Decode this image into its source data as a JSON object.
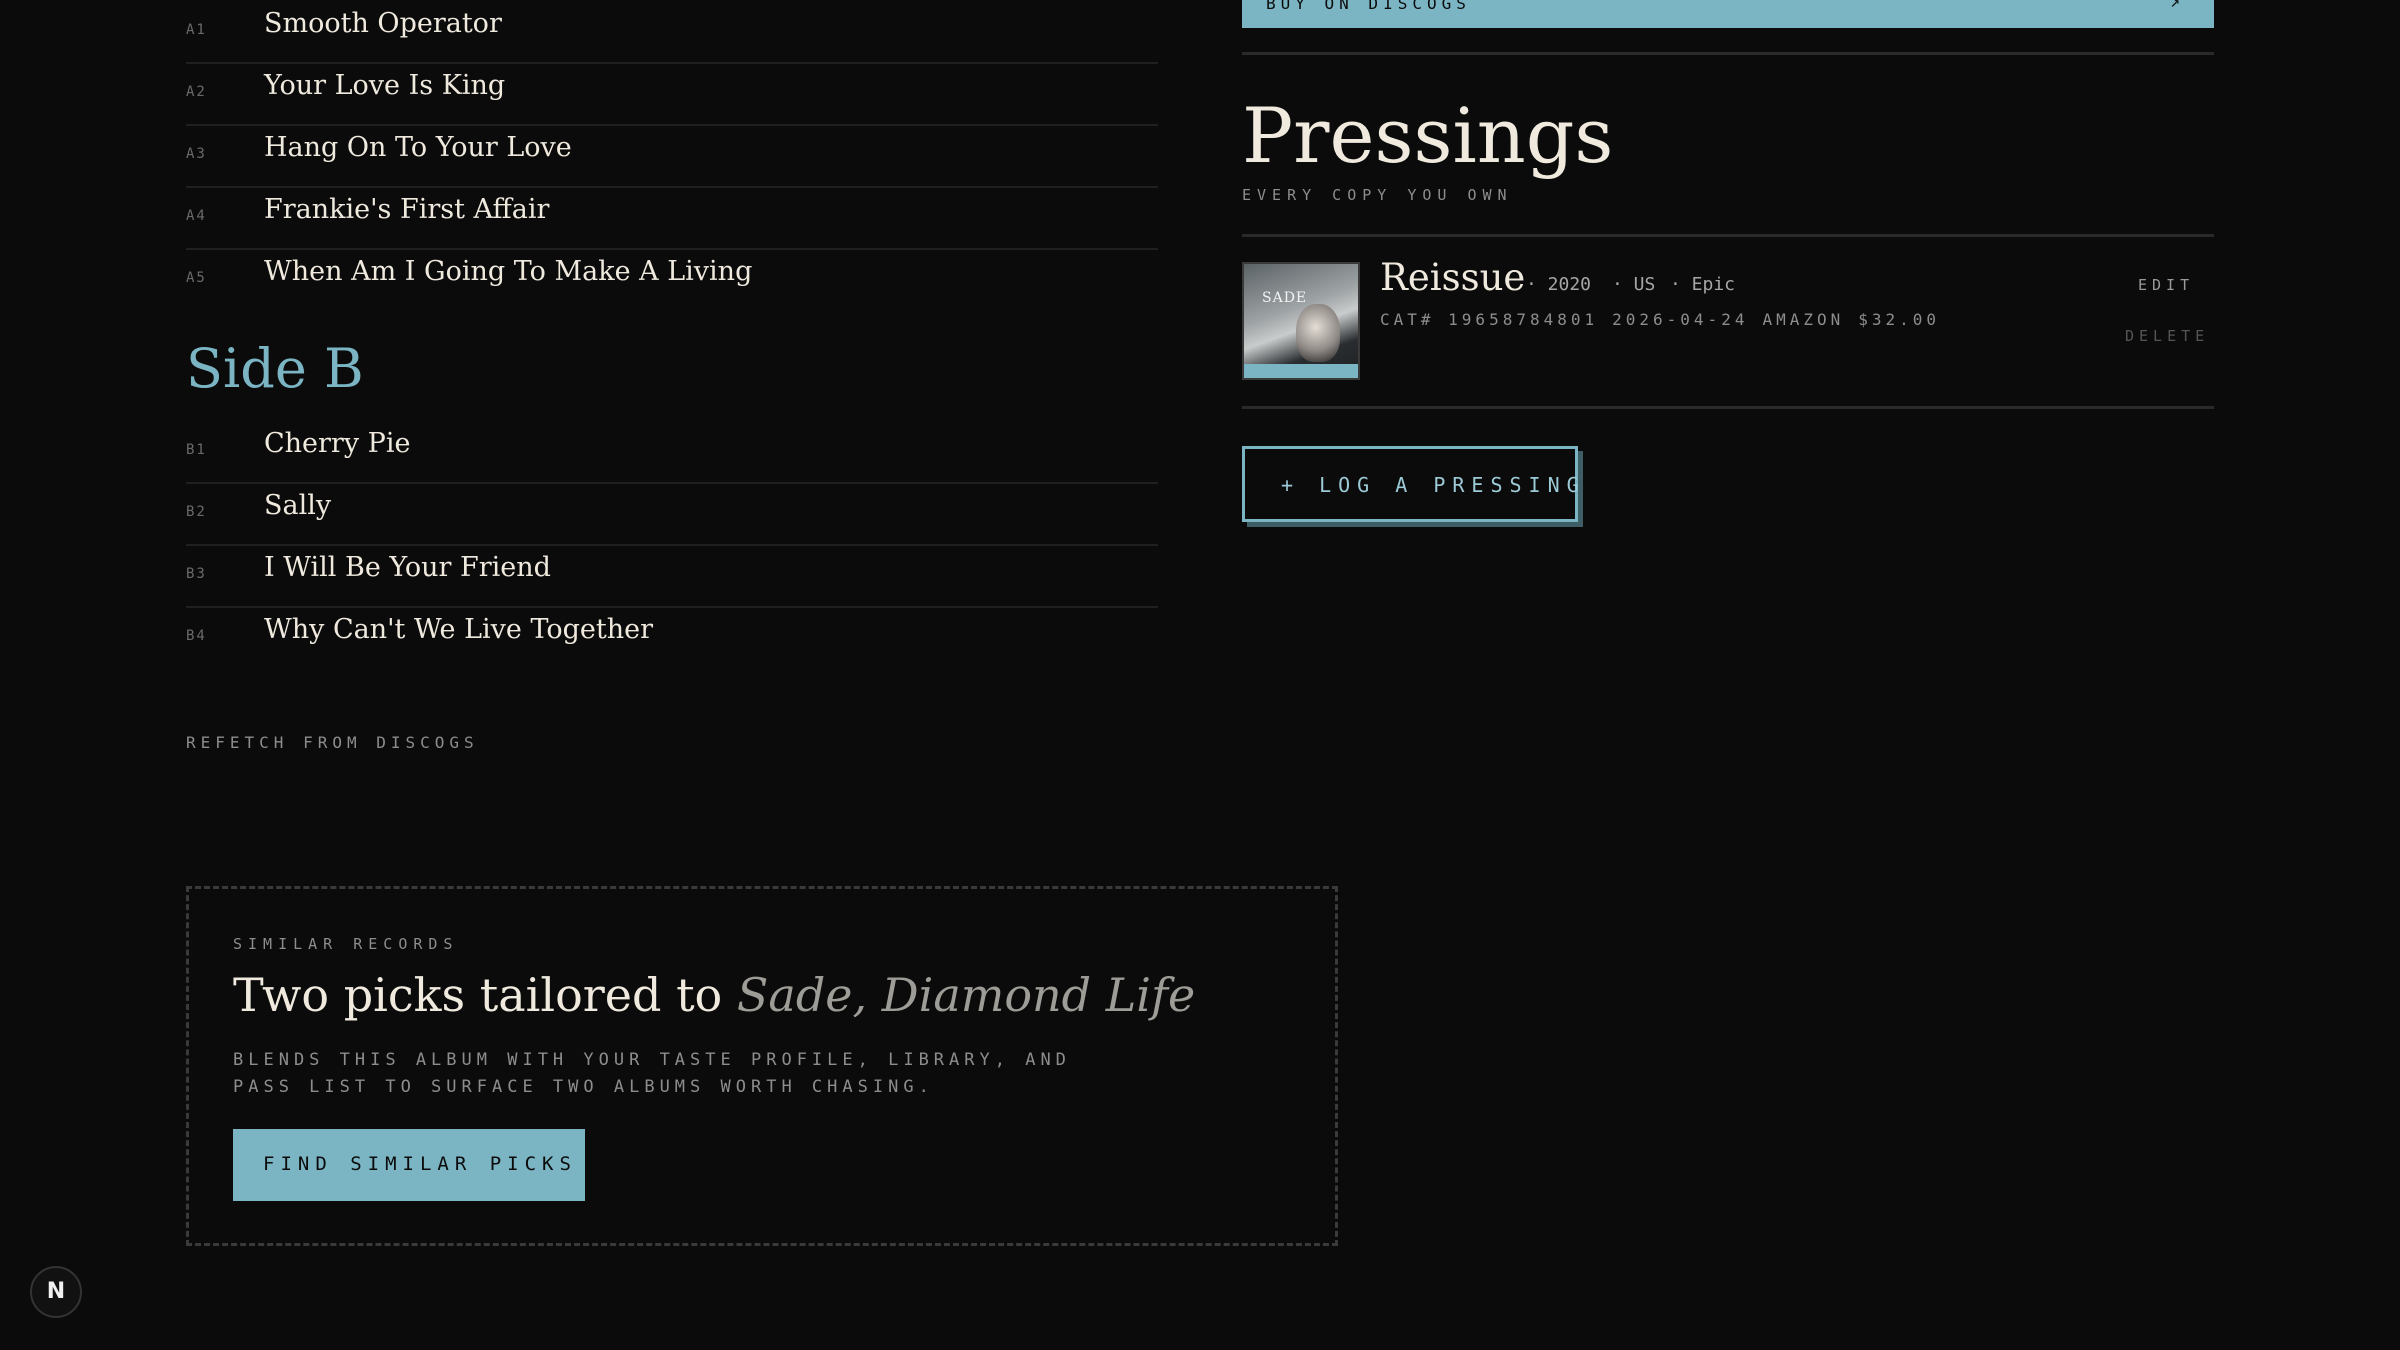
{
  "tracklist": {
    "side_a": [
      {
        "pos": "A1",
        "title": "Smooth Operator"
      },
      {
        "pos": "A2",
        "title": "Your Love Is King"
      },
      {
        "pos": "A3",
        "title": "Hang On To Your Love"
      },
      {
        "pos": "A4",
        "title": "Frankie's First Affair"
      },
      {
        "pos": "A5",
        "title": "When Am I Going To Make A Living"
      }
    ],
    "side_b_heading": "Side B",
    "side_b": [
      {
        "pos": "B1",
        "title": "Cherry Pie"
      },
      {
        "pos": "B2",
        "title": "Sally"
      },
      {
        "pos": "B3",
        "title": "I Will Be Your Friend"
      },
      {
        "pos": "B4",
        "title": "Why Can't We Live Together"
      }
    ],
    "refetch_label": "REFETCH FROM DISCOGS"
  },
  "discogs_bar": {
    "label": "BUY ON DISCOGS",
    "arrow": "↗"
  },
  "pressings": {
    "title": "Pressings",
    "subtitle": "EVERY COPY YOU OWN",
    "items": [
      {
        "name": "Reissue",
        "year": "· 2020",
        "country": "· US",
        "label": "· Epic",
        "catalog": "CAT# 19658784801",
        "date": "2026-04-24",
        "store": "AMAZON",
        "price": "$32.00",
        "cover_text": "SADE",
        "edit_label": "EDIT",
        "delete_label": "DELETE"
      }
    ],
    "log_button": "+ LOG A PRESSING"
  },
  "similar": {
    "eyebrow": "SIMILAR RECORDS",
    "headline_prefix": "Two picks tailored to",
    "headline_album": "Sade, Diamond Life",
    "description": "BLENDS THIS ALBUM WITH YOUR TASTE PROFILE, LIBRARY, AND PASS LIST TO SURFACE TWO ALBUMS WORTH CHASING.",
    "button": "FIND SIMILAR PICKS"
  },
  "badge": {
    "glyph": "N"
  },
  "colors": {
    "accent": "#7bb5c4",
    "background": "#0b0b0b",
    "text": "#ece6da",
    "muted": "#8d8d8d"
  }
}
